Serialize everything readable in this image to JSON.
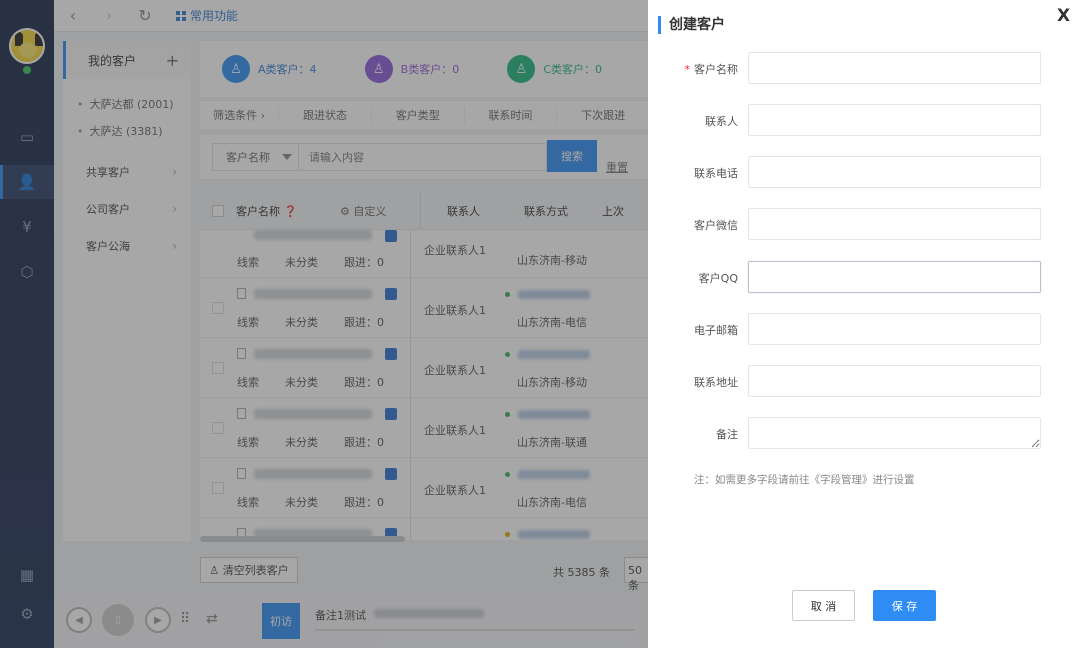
{
  "topbar": {
    "quick_label": "常用功能"
  },
  "sidebar": {
    "my_customers": "我的客户",
    "add_symbol": "+",
    "sub_items": [
      "大萨达都 (2001)",
      "大萨达 (3381)"
    ],
    "groups": [
      "共享客户",
      "公司客户",
      "客户公海"
    ]
  },
  "categories": [
    {
      "label": "A类客户：4",
      "color": "#2f8cf5"
    },
    {
      "label": "B类客户：0",
      "color": "#8e5cd9"
    },
    {
      "label": "C类客户：0",
      "color": "#1fb580"
    }
  ],
  "filters": [
    "筛选条件",
    "跟进状态",
    "客户类型",
    "联系时间",
    "下次跟进"
  ],
  "search": {
    "field": "客户名称",
    "placeholder": "请输入内容",
    "button": "搜索",
    "reset": "重置"
  },
  "table": {
    "headers": {
      "name": "客户名称",
      "custom": "自定义",
      "contact": "联系人",
      "method": "联系方式",
      "last": "上次"
    },
    "rows": [
      {
        "source": "线索",
        "category": "未分类",
        "follow": "跟进：0",
        "contact": "企业联系人1",
        "carrier": "山东济南-移动"
      },
      {
        "source": "线索",
        "category": "未分类",
        "follow": "跟进：0",
        "contact": "企业联系人1",
        "carrier": "山东济南-电信"
      },
      {
        "source": "线索",
        "category": "未分类",
        "follow": "跟进：0",
        "contact": "企业联系人1",
        "carrier": "山东济南-移动"
      },
      {
        "source": "线索",
        "category": "未分类",
        "follow": "跟进：0",
        "contact": "企业联系人1",
        "carrier": "山东济南-联通"
      },
      {
        "source": "线索",
        "category": "未分类",
        "follow": "跟进：0",
        "contact": "企业联系人1",
        "carrier": "山东济南-电信"
      }
    ]
  },
  "footer": {
    "clear_button": "清空列表客户",
    "total": "共 5385 条",
    "page_size": "50 条"
  },
  "bottom": {
    "tag": "初访",
    "note": "备注1测试"
  },
  "drawer": {
    "title": "创建客户",
    "close": "X",
    "fields": [
      {
        "label": "客户名称",
        "required": true,
        "value": ""
      },
      {
        "label": "联系人",
        "required": false,
        "value": ""
      },
      {
        "label": "联系电话",
        "required": false,
        "value": ""
      },
      {
        "label": "客户微信",
        "required": false,
        "value": ""
      },
      {
        "label": "客户QQ",
        "required": false,
        "value": ""
      },
      {
        "label": "电子邮箱",
        "required": false,
        "value": ""
      },
      {
        "label": "联系地址",
        "required": false,
        "value": ""
      },
      {
        "label": "备注",
        "required": false,
        "value": ""
      }
    ],
    "required_mark": "*",
    "hint": "注：如需更多字段请前往《字段管理》进行设置",
    "cancel": "取 消",
    "save": "保 存"
  }
}
